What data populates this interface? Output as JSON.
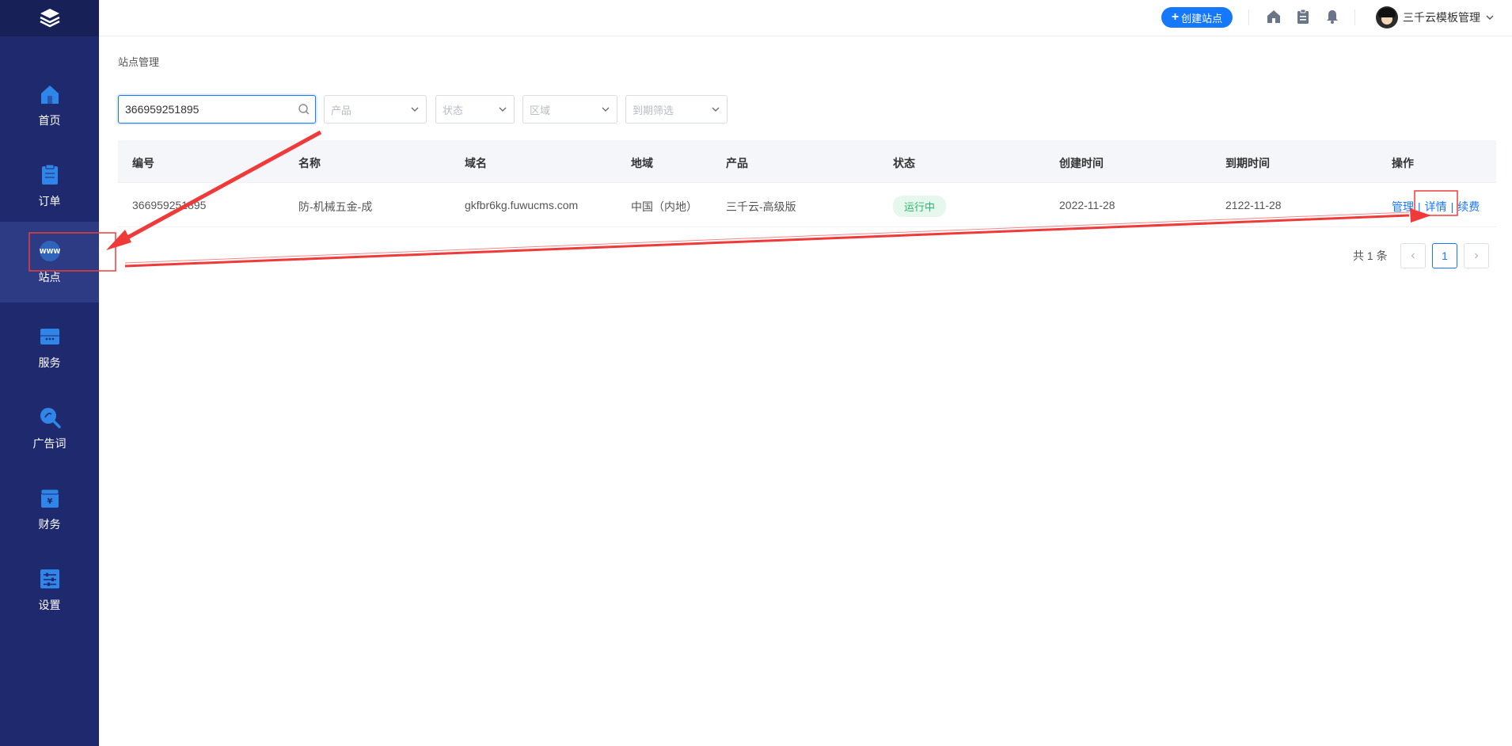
{
  "sidebar": {
    "logo_icon": "layers-logo-icon",
    "items": [
      {
        "label": "首页",
        "icon": "home-icon",
        "active": false
      },
      {
        "label": "订单",
        "icon": "order-icon",
        "active": false
      },
      {
        "label": "站点",
        "icon": "www-icon",
        "active": true
      },
      {
        "label": "服务",
        "icon": "service-icon",
        "active": false
      },
      {
        "label": "广告词",
        "icon": "keyword-icon",
        "active": false
      },
      {
        "label": "财务",
        "icon": "finance-icon",
        "active": false
      },
      {
        "label": "设置",
        "icon": "settings-icon",
        "active": false
      }
    ]
  },
  "header": {
    "create_label": "创建站点",
    "icons": [
      "home-icon",
      "clipboard-icon",
      "bell-icon"
    ],
    "user_name": "三千云模板管理"
  },
  "breadcrumb": "站点管理",
  "filters": {
    "search_value": "366959251895",
    "product_placeholder": "产品",
    "status_placeholder": "状态",
    "region_placeholder": "区域",
    "expire_placeholder": "到期筛选"
  },
  "table": {
    "columns": [
      "编号",
      "名称",
      "域名",
      "地域",
      "产品",
      "状态",
      "创建时间",
      "到期时间",
      "操作"
    ],
    "rows": [
      {
        "id": "366959251895",
        "name": "防-机械五金-成",
        "domain": "gkfbr6kg.fuwucms.com",
        "region": "中国（内地）",
        "product": "三千云-高级版",
        "status": "运行中",
        "created": "2022-11-28",
        "expires": "2122-11-28",
        "actions": [
          "管理",
          "详情",
          "续费"
        ]
      }
    ]
  },
  "pagination": {
    "total_text": "共 1 条",
    "current_page": "1"
  },
  "colors": {
    "sidebar_bg": "#1f2a6e",
    "primary": "#1677ff",
    "success": "#2fb46c",
    "annotation": "#f03a3a"
  }
}
